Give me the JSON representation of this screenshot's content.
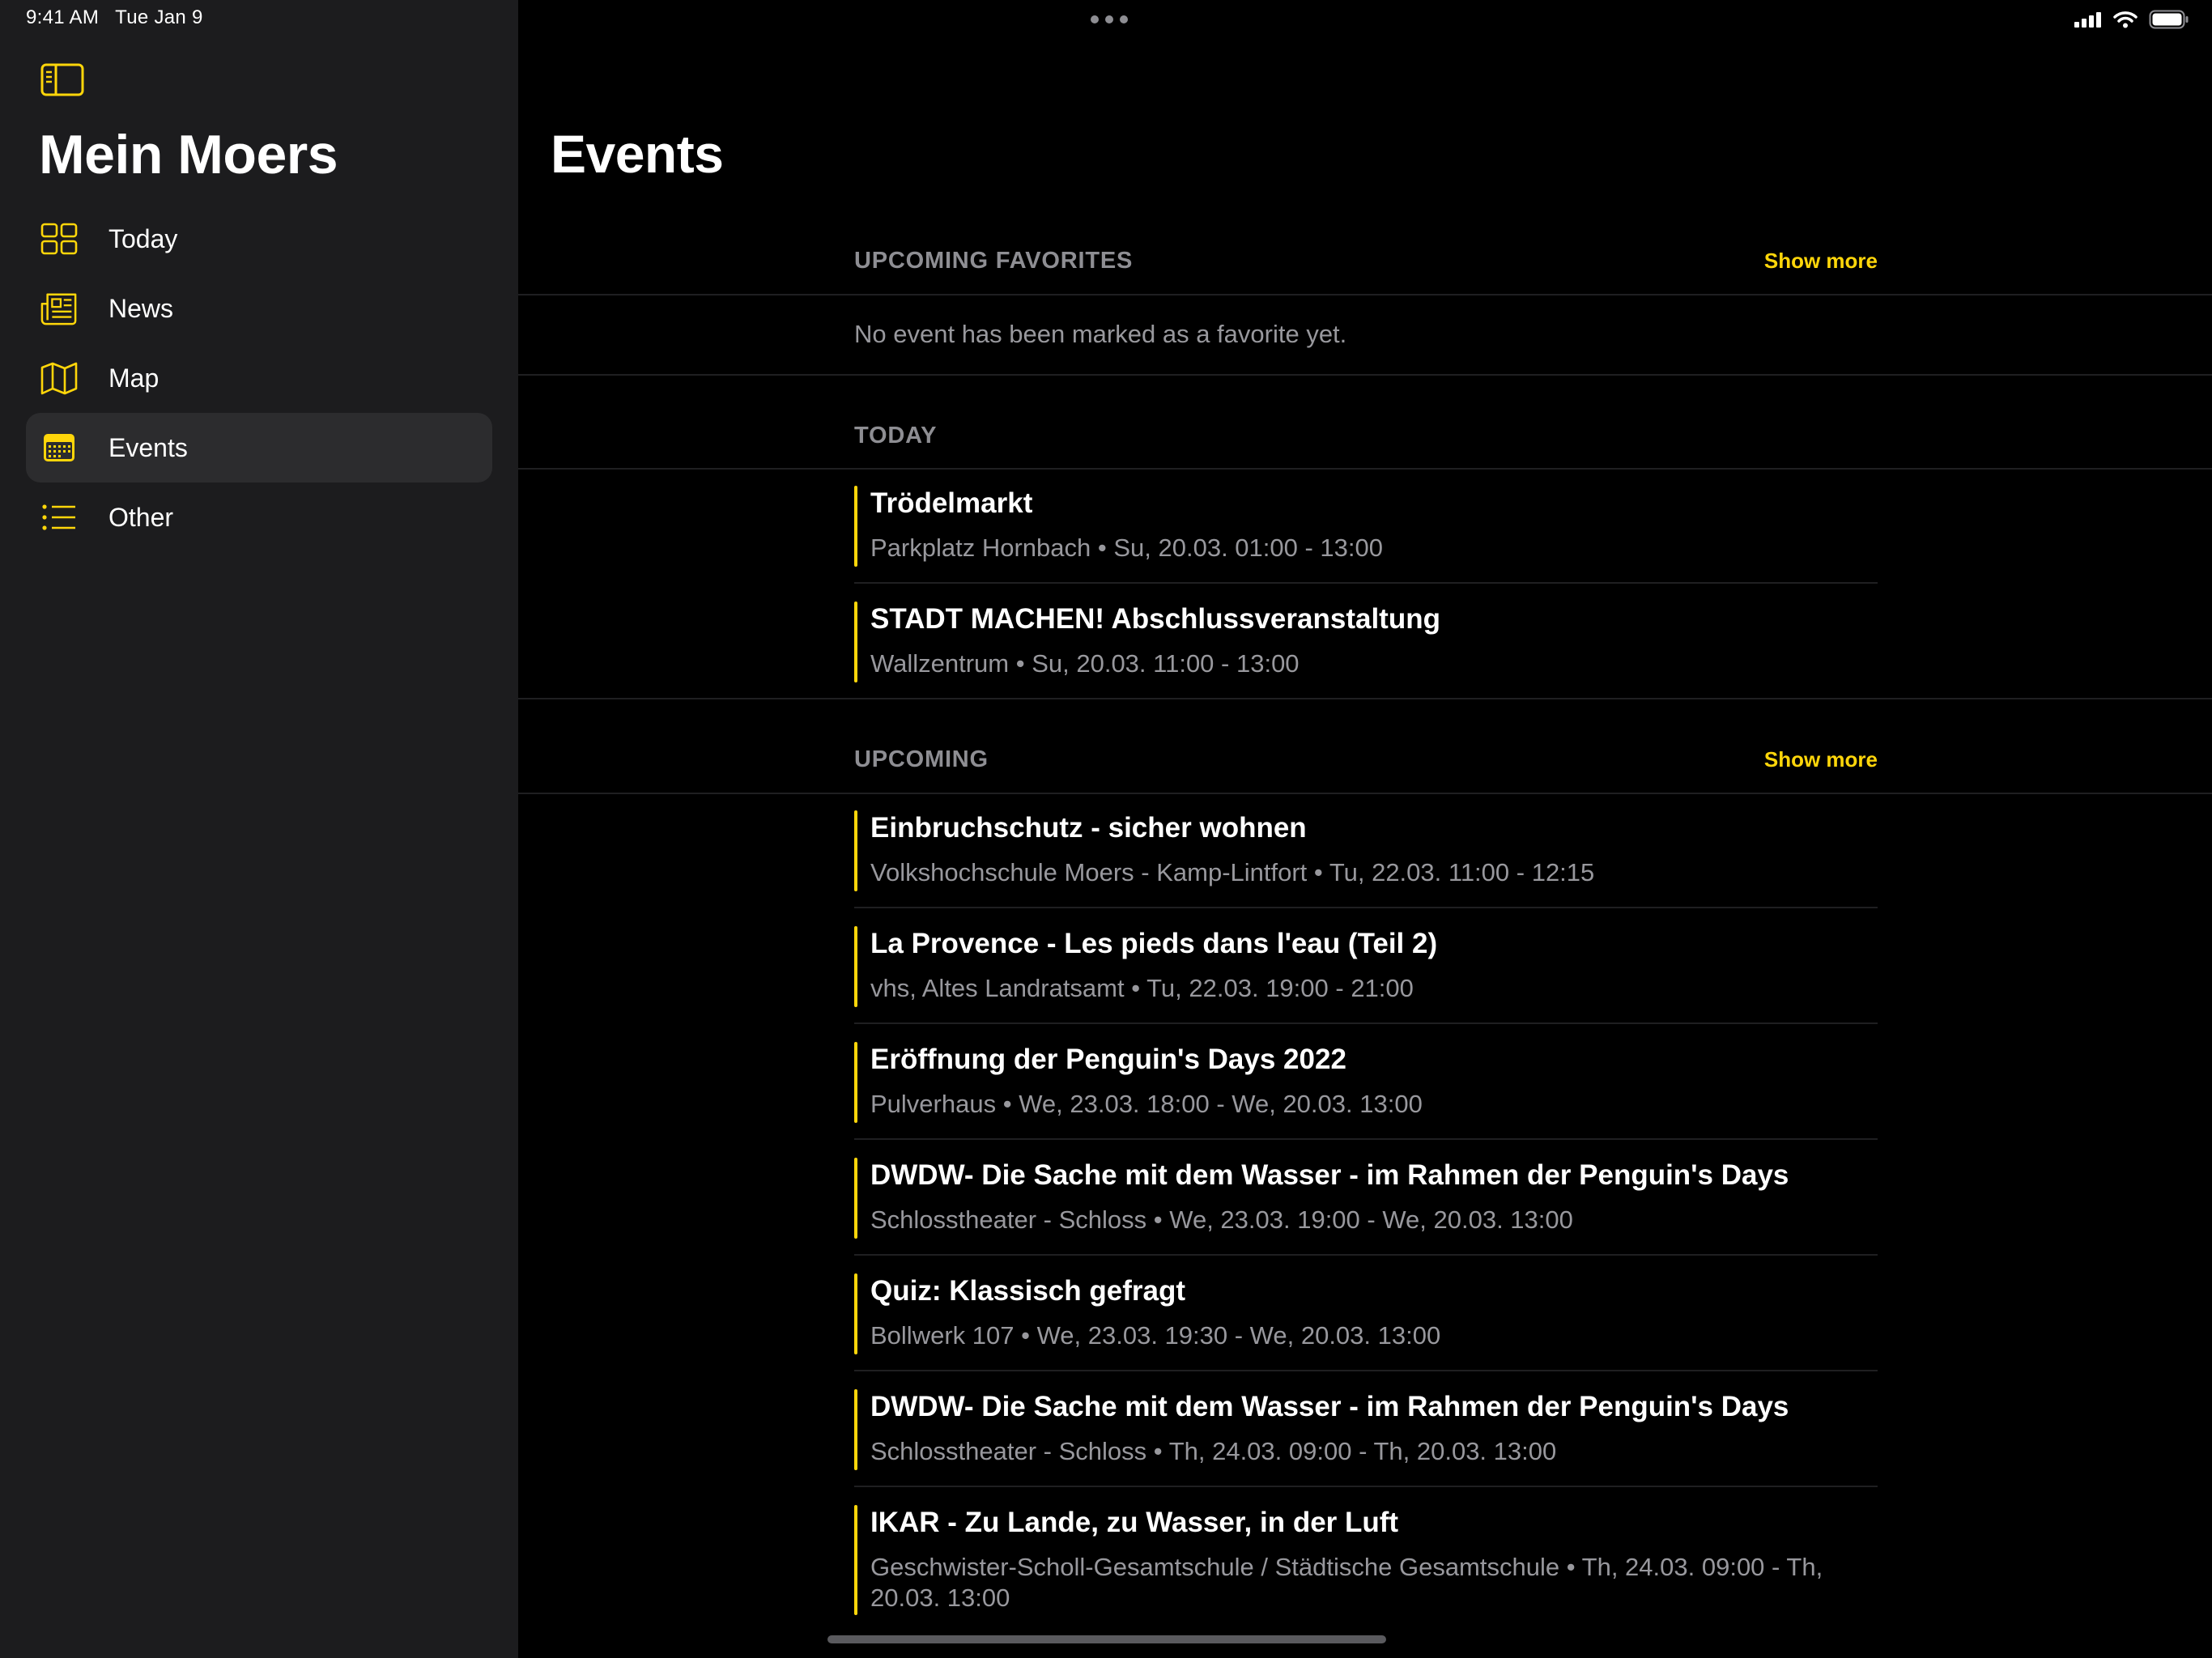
{
  "status": {
    "time": "9:41 AM",
    "date": "Tue Jan 9"
  },
  "sidebar": {
    "title": "Mein Moers",
    "items": [
      {
        "label": "Today",
        "icon": "grid-icon"
      },
      {
        "label": "News",
        "icon": "newspaper-icon"
      },
      {
        "label": "Map",
        "icon": "map-icon"
      },
      {
        "label": "Events",
        "icon": "calendar-icon",
        "selected": true
      },
      {
        "label": "Other",
        "icon": "list-icon"
      }
    ]
  },
  "main": {
    "title": "Events",
    "favorites": {
      "title": "UPCOMING FAVORITES",
      "show_more": "Show more",
      "empty_text": "No event has been marked as a favorite yet."
    },
    "today": {
      "title": "TODAY",
      "events": [
        {
          "title": "Trödelmarkt",
          "location": "Parkplatz Hornbach",
          "time": "Su, 20.03. 01:00 - 13:00"
        },
        {
          "title": "STADT MACHEN! Abschlussveranstaltung",
          "location": "Wallzentrum",
          "time": "Su, 20.03. 11:00 - 13:00"
        }
      ]
    },
    "upcoming": {
      "title": "UPCOMING",
      "show_more": "Show more",
      "events": [
        {
          "title": "Einbruchschutz - sicher wohnen",
          "location": "Volkshochschule Moers - Kamp-Lintfort",
          "time": "Tu, 22.03. 11:00 - 12:15"
        },
        {
          "title": "La Provence - Les pieds dans l'eau (Teil 2)",
          "location": "vhs, Altes Landratsamt",
          "time": "Tu, 22.03. 19:00 - 21:00"
        },
        {
          "title": "Eröffnung der Penguin's Days 2022",
          "location": "Pulverhaus",
          "time": "We, 23.03. 18:00 - We, 20.03. 13:00"
        },
        {
          "title": "DWDW- Die Sache mit dem Wasser - im Rahmen der Penguin's Days",
          "location": "Schlosstheater - Schloss",
          "time": "We, 23.03. 19:00 - We, 20.03. 13:00"
        },
        {
          "title": "Quiz: Klassisch gefragt",
          "location": "Bollwerk 107",
          "time": "We, 23.03. 19:30 - We, 20.03. 13:00"
        },
        {
          "title": "DWDW- Die Sache mit dem Wasser - im Rahmen der Penguin's Days",
          "location": "Schlosstheater - Schloss",
          "time": "Th, 24.03. 09:00 - Th, 20.03. 13:00"
        },
        {
          "title": "IKAR - Zu Lande, zu Wasser, in der Luft",
          "location": "Geschwister-Scholl-Gesamtschule / Städtische Gesamtschule",
          "time": "Th, 24.03. 09:00 - Th, 20.03. 13:00"
        }
      ]
    }
  },
  "colors": {
    "accent": "#ffd60a",
    "sidebar_bg": "#1c1c1e",
    "selected_bg": "#2c2c2e",
    "secondary_text": "#98989d"
  }
}
